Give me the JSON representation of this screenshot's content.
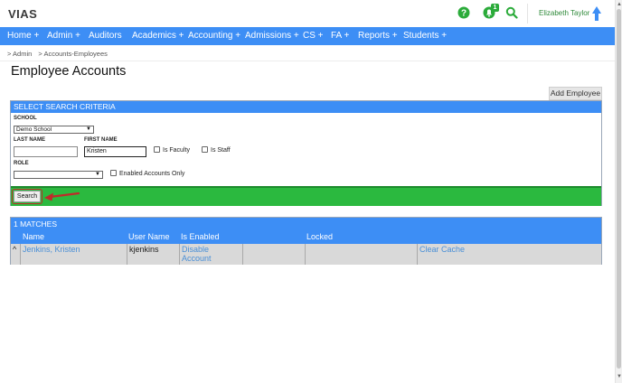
{
  "app": {
    "logo": "VIAS",
    "notification_count": "1",
    "user_name": "Elizabeth Taylor"
  },
  "nav": [
    {
      "label": "Home +"
    },
    {
      "label": "Admin +"
    },
    {
      "label": "Auditors"
    },
    {
      "label": "Academics +"
    },
    {
      "label": "Accounting +"
    },
    {
      "label": "Admissions +"
    },
    {
      "label": "CS +"
    },
    {
      "label": "FA +"
    },
    {
      "label": "Reports +"
    },
    {
      "label": "Students +"
    }
  ],
  "breadcrumb": [
    "> Admin",
    "> Accounts-Employees"
  ],
  "page_title": "Employee Accounts",
  "add_employee_label": "Add Employee",
  "search_panel": {
    "heading": "SELECT SEARCH CRITERIA",
    "school_label": "SCHOOL",
    "school_value": "Demo School",
    "last_name_label": "LAST NAME",
    "last_name_value": "",
    "first_name_label": "FIRST NAME",
    "first_name_value": "Kristen",
    "is_faculty_label": "Is Faculty",
    "is_staff_label": "Is Staff",
    "role_label": "ROLE",
    "role_value": "",
    "enabled_only_label": "Enabled Accounts Only",
    "search_button": "Search"
  },
  "results": {
    "count_label": "1 MATCHES",
    "columns": [
      "Name",
      "User Name",
      "Is Enabled",
      "Locked"
    ],
    "rows": [
      {
        "marker": "^",
        "name": "Jenkins, Kristen",
        "user_name": "kjenkins",
        "is_enabled": "Disable Account",
        "locked": "",
        "action": "Clear Cache"
      }
    ]
  },
  "colors": {
    "nav_blue": "#3d8ef5",
    "green_bar": "#2bb93f",
    "link_blue": "#4a8fd6",
    "annotation_red": "#c02a2a"
  }
}
